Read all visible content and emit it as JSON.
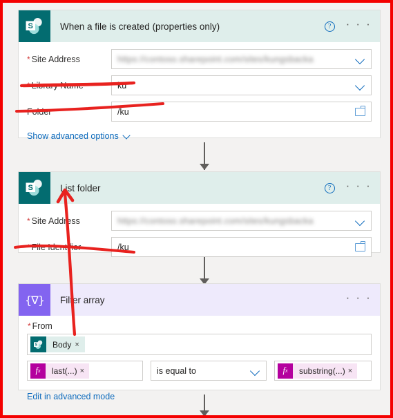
{
  "meta": {
    "app": "Power Automate flow designer",
    "accent_red": "#f40000",
    "sharepoint_teal": "#036c70",
    "filter_purple": "#8364f0",
    "link_blue": "#0f6cbd"
  },
  "cards": [
    {
      "id": "when-a-file-is-created",
      "title": "When a file is created (properties only)",
      "icon": "sharepoint-icon",
      "theme": "sharepoint",
      "help_label": "?",
      "more_label": "· · ·",
      "fields": [
        {
          "label": "Site Address",
          "required": true,
          "value": "https://contoso.sharepoint.com/sites/kungsbacka",
          "blurred": true,
          "control": "dropdown",
          "icon": "chevron-down-icon"
        },
        {
          "label": "Library Name",
          "required": true,
          "value": "ku",
          "blurred": false,
          "control": "dropdown",
          "icon": "chevron-down-icon"
        },
        {
          "label": "Folder",
          "required": false,
          "value": "/ku",
          "blurred": false,
          "control": "picker",
          "icon": "folder-picker-icon"
        }
      ],
      "advanced_link": "Show advanced options"
    },
    {
      "id": "list-folder",
      "title": "List folder",
      "icon": "sharepoint-icon",
      "theme": "sharepoint",
      "help_label": "?",
      "more_label": "· · ·",
      "fields": [
        {
          "label": "Site Address",
          "required": true,
          "value": "https://contoso.sharepoint.com/sites/kungsbacka",
          "blurred": true,
          "control": "dropdown",
          "icon": "chevron-down-icon"
        },
        {
          "label": "File Identifier",
          "required": true,
          "value": "/ku",
          "blurred": false,
          "control": "picker",
          "icon": "folder-picker-icon"
        }
      ]
    },
    {
      "id": "filter-array",
      "title": "Filter array",
      "icon": "filter-array-icon",
      "icon_glyph": "{∇}",
      "theme": "filter",
      "more_label": "· · ·",
      "from": {
        "label": "From",
        "required": true,
        "token": {
          "text": "Body",
          "icon": "sharepoint-token-icon",
          "remove_label": "×"
        }
      },
      "condition": {
        "left": {
          "text": "last(...)",
          "icon": "fx-icon",
          "remove_label": "×"
        },
        "operator": "is equal to",
        "operator_icon": "chevron-down-icon",
        "right": {
          "text": "substring(...)",
          "icon": "fx-icon",
          "remove_label": "×"
        }
      },
      "advanced_link": "Edit in advanced mode"
    }
  ],
  "connectors": [
    {
      "name": "connector-trigger-to-list-folder"
    },
    {
      "name": "connector-list-folder-to-filter-array"
    },
    {
      "name": "connector-filter-array-to-next"
    }
  ],
  "annotations": [
    {
      "name": "underline-library-name",
      "kind": "underline"
    },
    {
      "name": "underline-folder",
      "kind": "underline"
    },
    {
      "name": "underline-file-identifier",
      "kind": "underline"
    },
    {
      "name": "arrow-body-to-list-folder",
      "kind": "arrow"
    }
  ]
}
